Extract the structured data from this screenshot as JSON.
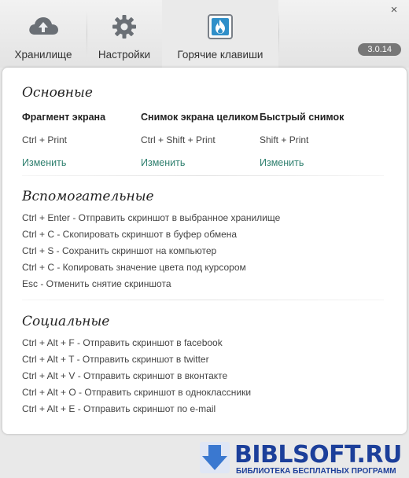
{
  "window": {
    "close_glyph": "×",
    "version": "3.0.14"
  },
  "toolbar": {
    "items": [
      {
        "label": "Хранилище",
        "icon": "cloud-upload-icon",
        "active": false
      },
      {
        "label": "Настройки",
        "icon": "gear-icon",
        "active": false
      },
      {
        "label": "Горячие клавиши",
        "icon": "flame-icon",
        "active": true
      }
    ]
  },
  "main": {
    "title": "Основные",
    "columns": [
      {
        "title": "Фрагмент экрана",
        "keys": "Ctrl + Print",
        "link": "Изменить"
      },
      {
        "title": "Снимок экрана целиком",
        "keys": "Ctrl + Shift + Print",
        "link": "Изменить"
      },
      {
        "title": "Быстрый снимок",
        "keys": "Shift + Print",
        "link": "Изменить"
      }
    ]
  },
  "auxiliary": {
    "title": "Вспомогательные",
    "lines": [
      "Ctrl + Enter - Отправить скриншот в выбранное хранилище",
      "Ctrl + C - Скопировать скриншот в буфер обмена",
      "Ctrl + S - Сохранить скриншот на компьютер",
      "Ctrl + C - Копировать значение цвета под курсором",
      "Esc - Отменить снятие скриншота"
    ]
  },
  "social": {
    "title": "Социальные",
    "lines": [
      "Ctrl + Alt + F - Отправить скриншот в facebook",
      "Ctrl + Alt + T - Отправить скриншот в twitter",
      "Ctrl + Alt + V - Отправить скриншот в вконтакте",
      "Ctrl + Alt + O - Отправить скриншот в одноклассники",
      "Ctrl + Alt + E - Отправить скриншот по e-mail"
    ]
  },
  "watermark": {
    "brand": "BIBLSOFT.RU",
    "tagline": "БИБЛИОТЕКА БЕСПЛАТНЫХ ПРОГРАММ"
  },
  "colors": {
    "link": "#2e7f6e",
    "version_badge": "#777777",
    "watermark": "#1c3f9a"
  }
}
